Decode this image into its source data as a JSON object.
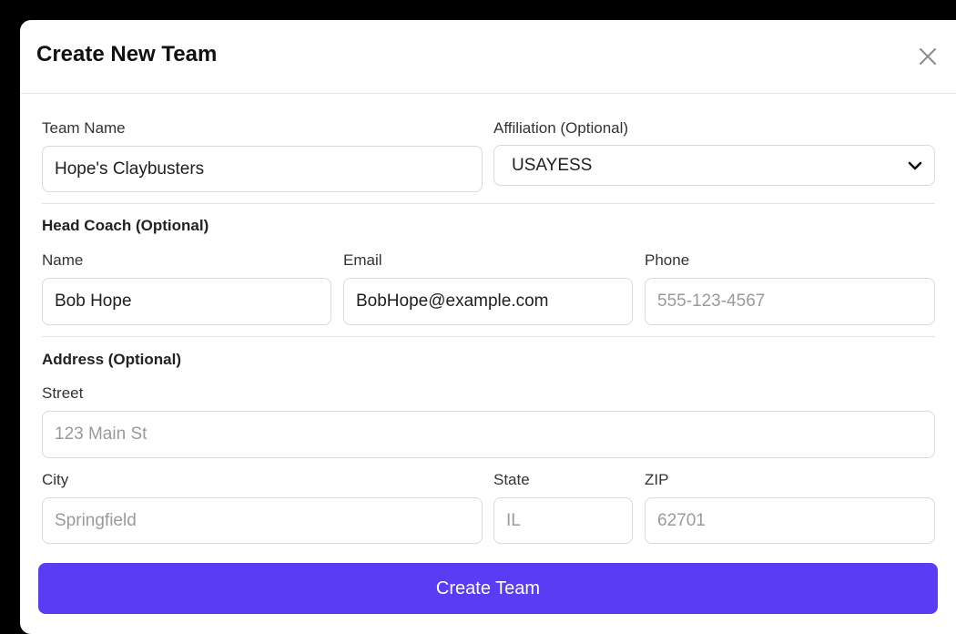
{
  "modal": {
    "title": "Create New Team",
    "close_icon": "close-icon"
  },
  "team": {
    "name_label": "Team Name",
    "name_value": "Hope's Claybusters",
    "affiliation_label": "Affiliation (Optional)",
    "affiliation_value": "USAYESS",
    "affiliation_icon": "chevron-down-icon"
  },
  "coach": {
    "section_title": "Head Coach (Optional)",
    "name_label": "Name",
    "name_value": "Bob Hope",
    "email_label": "Email",
    "email_value": "BobHope@example.com",
    "phone_label": "Phone",
    "phone_value": "",
    "phone_placeholder": "555-123-4567"
  },
  "address": {
    "section_title": "Address (Optional)",
    "street_label": "Street",
    "street_value": "",
    "street_placeholder": "123 Main St",
    "city_label": "City",
    "city_value": "",
    "city_placeholder": "Springfield",
    "state_label": "State",
    "state_value": "",
    "state_placeholder": "IL",
    "zip_label": "ZIP",
    "zip_value": "",
    "zip_placeholder": "62701"
  },
  "actions": {
    "submit_label": "Create Team"
  },
  "colors": {
    "primary": "#5b3cf5",
    "border": "#d7d9de",
    "backdrop": "#000000"
  }
}
